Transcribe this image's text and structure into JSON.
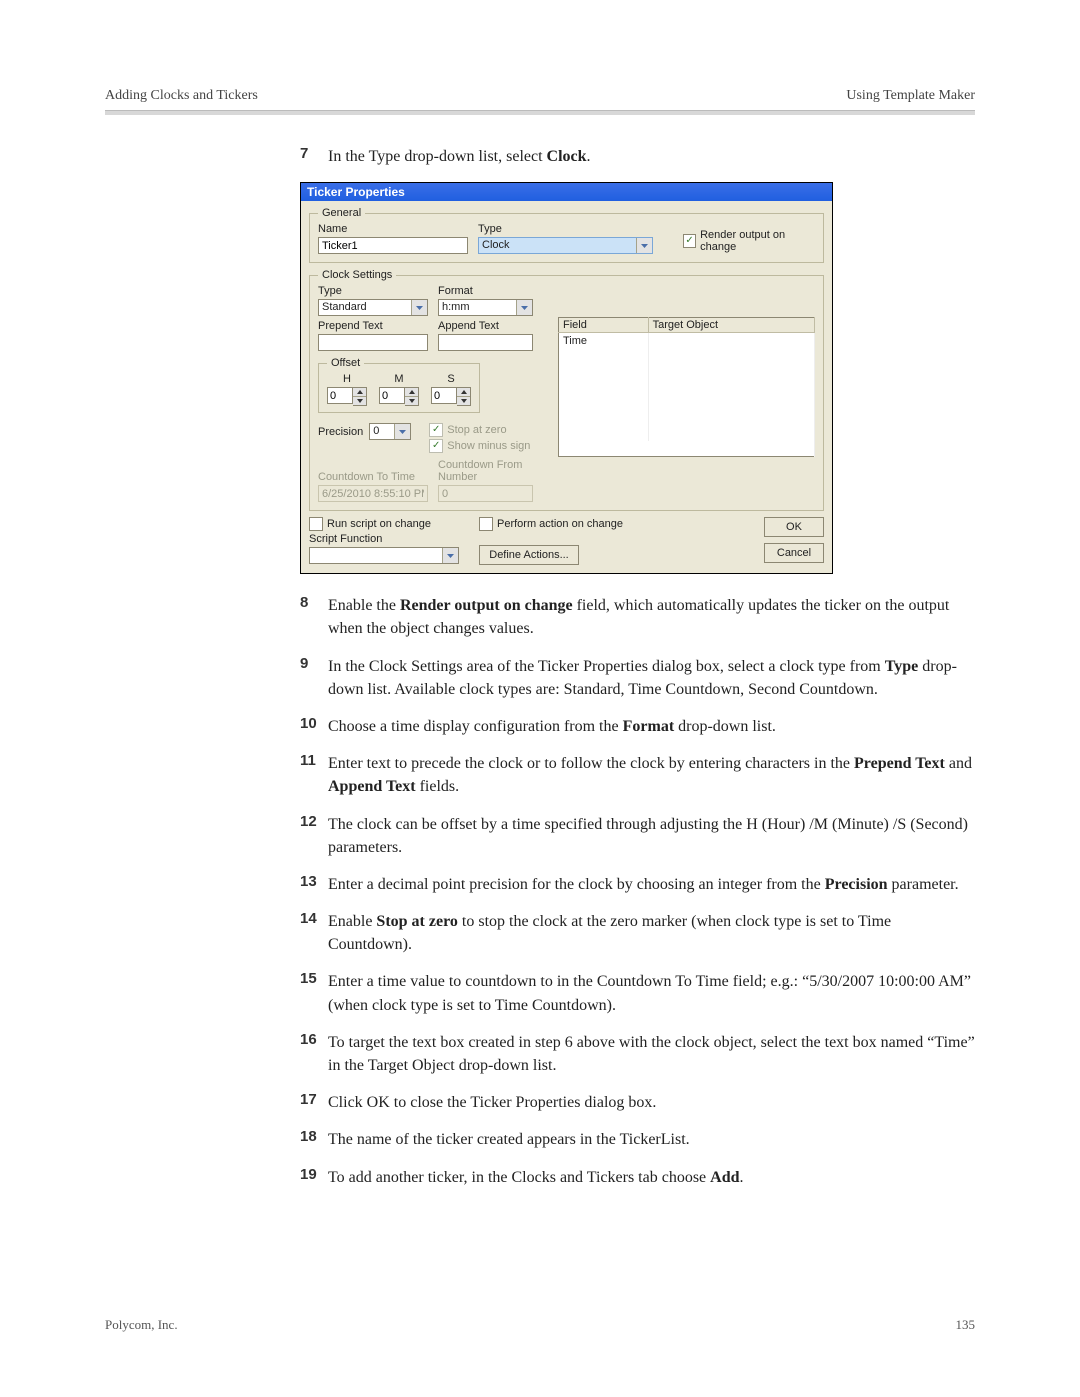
{
  "header": {
    "left": "Adding Clocks and Tickers",
    "right": "Using Template Maker"
  },
  "footer": {
    "left": "Polycom, Inc.",
    "right": "135"
  },
  "steps": {
    "7": {
      "num": "7",
      "pre": "In the Type drop-down list, select ",
      "bold": "Clock",
      "post": "."
    },
    "8": {
      "num": "8",
      "pre": "Enable the ",
      "bold": "Render output on change",
      "post": " field, which automatically updates the ticker on the output when the object changes values."
    },
    "9": {
      "num": "9",
      "pre": "In the Clock Settings area of the Ticker Properties dialog box, select a clock type from ",
      "bold": "Type",
      "post": " drop-down list. Available clock types are: Standard, Time Countdown, Second Countdown."
    },
    "10": {
      "num": "10",
      "pre": "Choose a time display configuration from the ",
      "bold": "Format",
      "post": " drop-down list."
    },
    "11": {
      "num": "11",
      "pre": "Enter text to precede the clock or to follow the clock by entering characters in the ",
      "bold": "Prepend Text",
      "post_no_space": " and ",
      "bold2": "Append Text",
      "post2": " fields."
    },
    "12": {
      "num": "12",
      "text": "The clock can be offset by a time specified through adjusting the H (Hour) /M (Minute) /S (Second) parameters."
    },
    "13": {
      "num": "13",
      "pre": "Enter a decimal point precision for the clock by choosing an integer from the ",
      "bold": "Precision",
      "post": " parameter."
    },
    "14": {
      "num": "14",
      "pre": "Enable ",
      "bold": "Stop at zero",
      "post": " to stop the clock at the zero marker (when clock type is set to Time Countdown)."
    },
    "15": {
      "num": "15",
      "text": "Enter a time value to countdown to in the Countdown To Time field; e.g.: “5/30/2007 10:00:00 AM” (when clock type is set to Time Countdown)."
    },
    "16": {
      "num": "16",
      "text": "To target the text box created in step 6 above with the clock object, select the text box named “Time” in the Target Object drop-down list."
    },
    "17": {
      "num": "17",
      "text": "Click OK to close the Ticker Properties dialog box."
    },
    "18": {
      "num": "18",
      "text": "The name of the ticker created appears in the TickerList."
    },
    "19": {
      "num": "19",
      "pre": "To add another ticker, in the Clocks and Tickers tab choose ",
      "bold": "Add",
      "post": "."
    }
  },
  "dlg": {
    "title": "Ticker Properties",
    "general": {
      "legend": "General",
      "name_lbl": "Name",
      "name_val": "Ticker1",
      "type_lbl": "Type",
      "type_val": "Clock",
      "render_cb": "Render output on change"
    },
    "clock": {
      "legend": "Clock Settings",
      "type_lbl": "Type",
      "type_val": "Standard",
      "format_lbl": "Format",
      "format_val": "h:mm",
      "prepend_lbl": "Prepend Text",
      "prepend_val": "",
      "append_lbl": "Append Text",
      "append_val": "",
      "offset_legend": "Offset",
      "H": "H",
      "M": "M",
      "S": "S",
      "h_val": "0",
      "m_val": "0",
      "s_val": "0",
      "precision_lbl": "Precision",
      "precision_val": "0",
      "stop_zero": "Stop at zero",
      "show_minus": "Show minus sign",
      "cd_to_lbl": "Countdown To Time",
      "cd_to_val": "6/25/2010 8:55:10 PM",
      "cd_from_lbl": "Countdown From Number",
      "cd_from_val": "0",
      "tbl_field": "Field",
      "tbl_target": "Target Object",
      "tbl_row_field": "Time"
    },
    "script": {
      "run_cb": "Run script on change",
      "fn_lbl": "Script Function",
      "fn_val": "",
      "perform_cb": "Perform action on change",
      "define_btn": "Define Actions...",
      "ok": "OK",
      "cancel": "Cancel"
    }
  }
}
